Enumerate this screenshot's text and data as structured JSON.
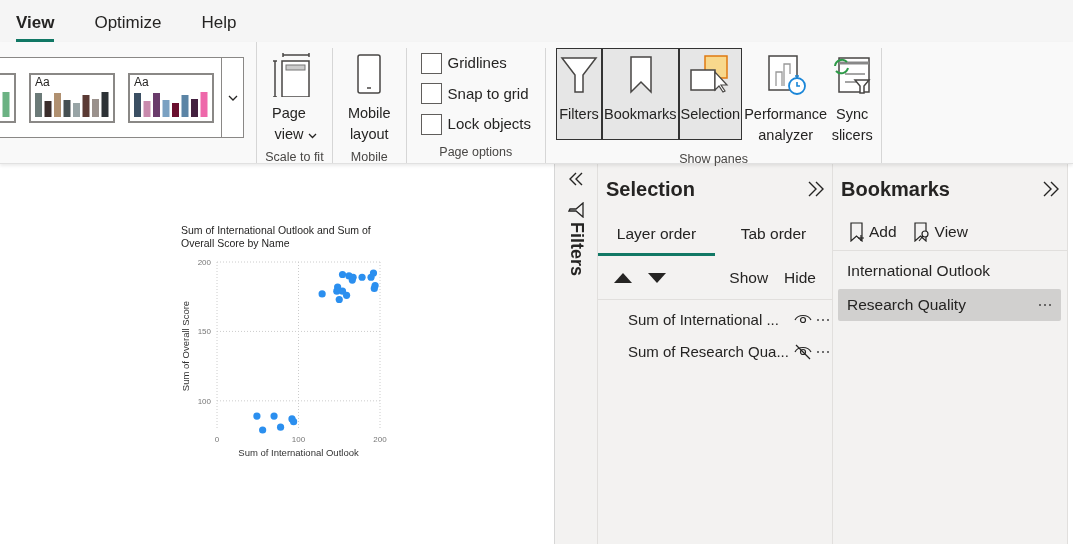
{
  "tabs": [
    {
      "label": "View",
      "selected": true
    },
    {
      "label": "Optimize",
      "selected": false
    },
    {
      "label": "Help",
      "selected": false
    }
  ],
  "ribbon": {
    "themes": [
      {
        "kind": "cut"
      },
      {
        "kind": "full",
        "sample": "Aa"
      },
      {
        "kind": "full",
        "sample": "Aa"
      }
    ],
    "groups": [
      {
        "label": "Scale to fit",
        "buttons": [
          {
            "kind": "page-view",
            "label": "Page view",
            "dropdown": true
          }
        ]
      },
      {
        "label": "Mobile",
        "buttons": [
          {
            "kind": "mobile",
            "label": "Mobile layout"
          }
        ]
      },
      {
        "label": "Page options",
        "checks": [
          {
            "label": "Gridlines",
            "checked": false
          },
          {
            "label": "Snap to grid",
            "checked": false
          },
          {
            "label": "Lock objects",
            "checked": false
          }
        ]
      },
      {
        "label": "Show panes",
        "buttons": [
          {
            "kind": "filters",
            "label": "Filters",
            "on": true
          },
          {
            "kind": "bookmarks",
            "label": "Bookmarks",
            "on": true
          },
          {
            "kind": "selection",
            "label": "Selection",
            "on": true
          },
          {
            "kind": "performance",
            "label": "Performance analyzer",
            "on": false
          },
          {
            "kind": "sync",
            "label": "Sync slicers",
            "on": false
          }
        ]
      }
    ]
  },
  "visual": {
    "chart_data": {
      "type": "scatter",
      "title": "Sum of International Outlook and Sum of Overall Score by Name",
      "xlabel": "Sum of International Outlook",
      "ylabel": "Sum of Overall Score",
      "grid": true,
      "xlim": [
        0,
        200
      ],
      "ylim": [
        79,
        200
      ],
      "xticks": [
        0,
        100,
        200
      ],
      "yticks": [
        100,
        150,
        200
      ],
      "series": [
        {
          "color": "#2b8fef",
          "x": [
            49,
            70,
            56,
            78,
            92,
            94,
            129,
            148,
            147,
            154,
            150,
            159,
            154,
            162,
            167,
            166,
            178,
            189,
            192,
            194,
            193
          ],
          "values": [
            89,
            89,
            79,
            81,
            87,
            85,
            177,
            182,
            179,
            179,
            173,
            176,
            191,
            190,
            189,
            187,
            189,
            189,
            192,
            183,
            181
          ]
        }
      ]
    }
  },
  "filters_pane": {
    "label": "Filters"
  },
  "selection_pane": {
    "title": "Selection",
    "tabs": [
      {
        "label": "Layer order",
        "selected": true
      },
      {
        "label": "Tab order",
        "selected": false
      }
    ],
    "show": "Show",
    "hide": "Hide",
    "layers": [
      {
        "label": "Sum of International ...",
        "visible": true
      },
      {
        "label": "Sum of Research Qua...",
        "visible": false
      }
    ]
  },
  "bookmarks_pane": {
    "title": "Bookmarks",
    "add": "Add",
    "view": "View",
    "items": [
      {
        "label": "International Outlook",
        "selected": false
      },
      {
        "label": "Research Quality",
        "selected": true
      }
    ]
  }
}
